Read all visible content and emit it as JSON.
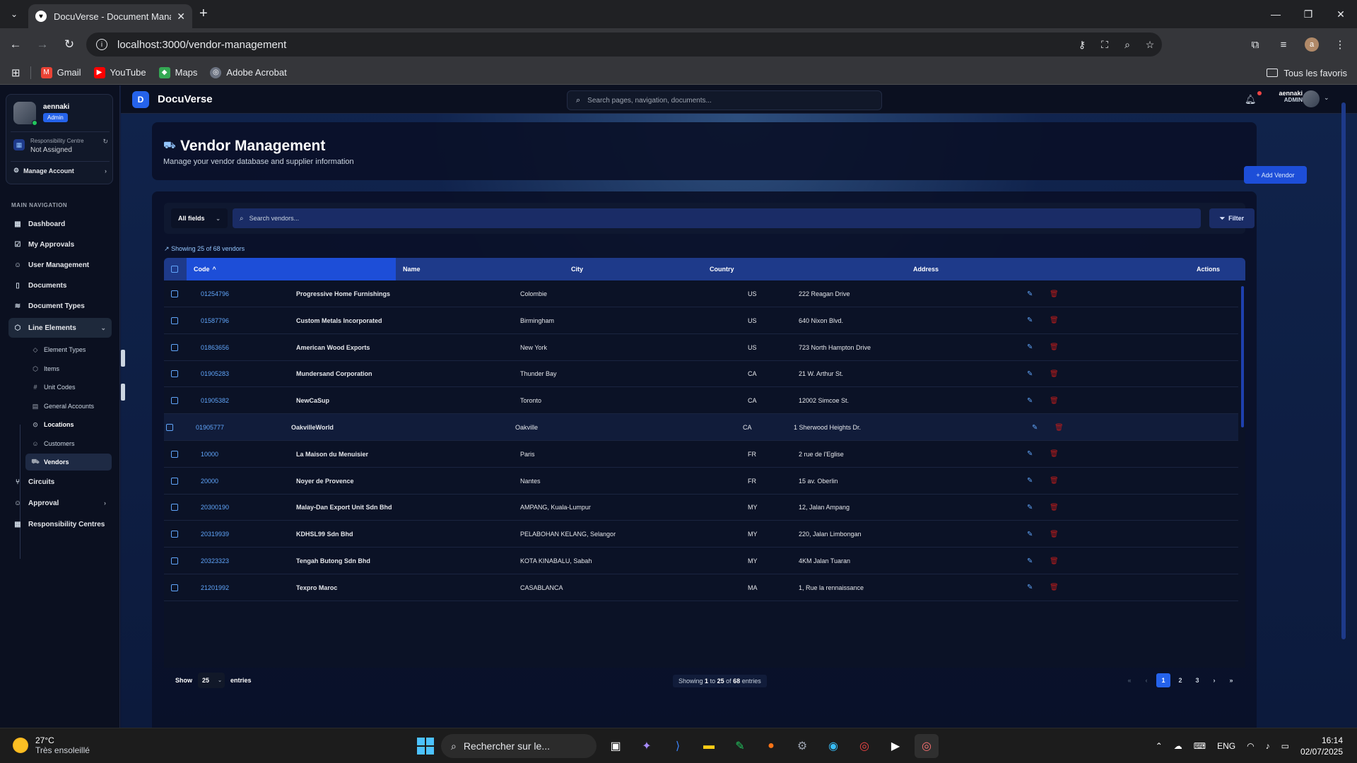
{
  "browser": {
    "tab_title": "DocuVerse - Document Management",
    "url": "localhost:3000/vendor-management",
    "bookmarks": [
      {
        "label": "Gmail",
        "color": "#ea4335"
      },
      {
        "label": "YouTube",
        "color": "#ff0000"
      },
      {
        "label": "Maps",
        "color": "#34a853"
      },
      {
        "label": "Adobe Acrobat",
        "color": "#9ca3af"
      }
    ],
    "all_bookmarks": "Tous les favoris",
    "profile_initial": "a"
  },
  "sidebar": {
    "user_name": "aennaki",
    "user_role": "Admin",
    "rc_title": "Responsibility Centre",
    "rc_value": "Not Assigned",
    "manage_account": "Manage Account",
    "nav_heading": "MAIN NAVIGATION",
    "items": [
      {
        "label": "Dashboard",
        "icon": "dashboard-icon"
      },
      {
        "label": "My Approvals",
        "icon": "clipboard-check-icon"
      },
      {
        "label": "User Management",
        "icon": "users-icon"
      },
      {
        "label": "Documents",
        "icon": "file-icon"
      },
      {
        "label": "Document Types",
        "icon": "layers-icon"
      },
      {
        "label": "Line Elements",
        "icon": "box-icon"
      },
      {
        "label": "Circuits",
        "icon": "git-branch-icon"
      },
      {
        "label": "Approval",
        "icon": "user-check-icon"
      },
      {
        "label": "Responsibility Centres",
        "icon": "building-icon"
      }
    ],
    "sub_items": [
      {
        "label": "Element Types",
        "icon": "tag-icon"
      },
      {
        "label": "Items",
        "icon": "package-icon"
      },
      {
        "label": "Unit Codes",
        "icon": "hash-icon"
      },
      {
        "label": "General Accounts",
        "icon": "calculator-icon"
      },
      {
        "label": "Locations",
        "icon": "map-pin-icon"
      },
      {
        "label": "Customers",
        "icon": "user-icon"
      },
      {
        "label": "Vendors",
        "icon": "truck-icon"
      }
    ]
  },
  "topbar": {
    "app_name": "DocuVerse",
    "logo_letter": "D",
    "search_placeholder": "Search pages, navigation, documents...",
    "user_name": "aennaki",
    "user_role": "ADMIN"
  },
  "page": {
    "title": "Vendor Management",
    "subtitle": "Manage your vendor database and supplier information",
    "add_button": "+ Add Vendor",
    "field_select": "All fields",
    "search_placeholder": "Search vendors...",
    "filter_button": "Filter",
    "showing_text": "Showing 25 of 68 vendors"
  },
  "table": {
    "columns": [
      "Code",
      "Name",
      "City",
      "Country",
      "Address",
      "Actions"
    ],
    "sort_indicator": "^",
    "rows": [
      {
        "code": "01254796",
        "name": "Progressive Home Furnishings",
        "city": "Colombie",
        "country": "US",
        "address": "222 Reagan Drive"
      },
      {
        "code": "01587796",
        "name": "Custom Metals Incorporated",
        "city": "Birmingham",
        "country": "US",
        "address": "640 Nixon Blvd."
      },
      {
        "code": "01863656",
        "name": "American Wood Exports",
        "city": "New York",
        "country": "US",
        "address": "723 North Hampton Drive"
      },
      {
        "code": "01905283",
        "name": "Mundersand Corporation",
        "city": "Thunder Bay",
        "country": "CA",
        "address": "21 W. Arthur St."
      },
      {
        "code": "01905382",
        "name": "NewCaSup",
        "city": "Toronto",
        "country": "CA",
        "address": "12002 Simcoe St."
      },
      {
        "code": "01905777",
        "name": "OakvilleWorld",
        "city": "Oakville",
        "country": "CA",
        "address": "1 Sherwood Heights Dr."
      },
      {
        "code": "10000",
        "name": "La Maison du Menuisier",
        "city": "Paris",
        "country": "FR",
        "address": "2 rue de l'Eglise"
      },
      {
        "code": "20000",
        "name": "Noyer de Provence",
        "city": "Nantes",
        "country": "FR",
        "address": "15 av. Oberlin"
      },
      {
        "code": "20300190",
        "name": "Malay-Dan Export Unit Sdn Bhd",
        "city": "AMPANG, Kuala-Lumpur",
        "country": "MY",
        "address": "12, Jalan Ampang"
      },
      {
        "code": "20319939",
        "name": "KDHSL99 Sdn Bhd",
        "city": "PELABOHAN KELANG, Selangor",
        "country": "MY",
        "address": "220, Jalan Limbongan"
      },
      {
        "code": "20323323",
        "name": "Tengah Butong Sdn Bhd",
        "city": "KOTA KINABALU, Sabah",
        "country": "MY",
        "address": "4KM Jalan Tuaran"
      },
      {
        "code": "21201992",
        "name": "Texpro Maroc",
        "city": "CASABLANCA",
        "country": "MA",
        "address": "1, Rue la rennaissance"
      }
    ]
  },
  "footer": {
    "show_label": "Show",
    "page_size": "25",
    "entries_label": "entries",
    "info_prefix": "Showing",
    "info_from": "1",
    "info_to_word": "to",
    "info_to": "25",
    "info_of_word": "of",
    "info_total": "68",
    "info_suffix": "entries",
    "pages": [
      "1",
      "2",
      "3"
    ]
  },
  "taskbar": {
    "temperature": "27°C",
    "weather": "Très ensoleillé",
    "search_placeholder": "Rechercher sur le...",
    "language": "ENG",
    "time": "16:14",
    "date": "02/07/2025"
  }
}
